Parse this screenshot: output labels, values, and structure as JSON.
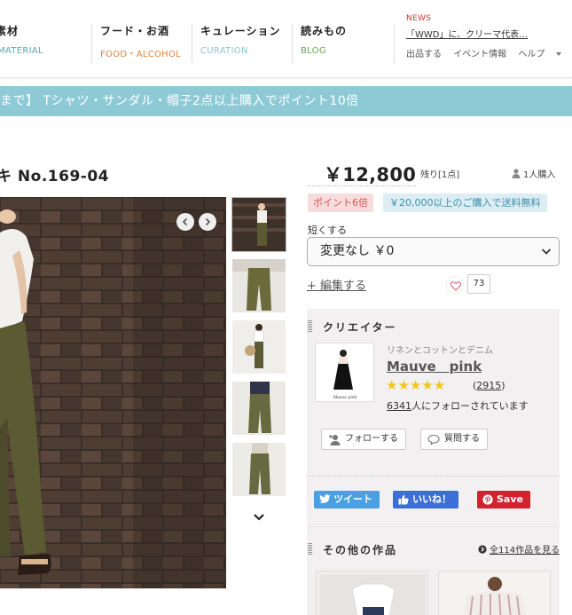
{
  "nav": {
    "items": [
      {
        "jp": "素材",
        "en": "MATERIAL"
      },
      {
        "jp": "フード・お酒",
        "en": "FOOD・ALCOHOL"
      },
      {
        "jp": "キュレーション",
        "en": "CURATION"
      },
      {
        "jp": "読みもの",
        "en": "BLOG"
      }
    ],
    "news_label": "NEWS",
    "news_text": "「WWD」に、クリーマ代表…",
    "links": [
      "出品する",
      "イベント情報",
      "ヘルプ"
    ]
  },
  "banner": {
    "text": "まで】 Tシャツ・サンダル・帽子2点以上購入でポイント10倍"
  },
  "product": {
    "title": "キ No.169-04",
    "price": "￥12,800",
    "stock": "残り[1点]",
    "buyers": "1人購入",
    "point_badge": "ポイント6倍",
    "shipping_badge": "￥20,000以上のご購入で送料無料",
    "option_label": "短くする",
    "option_value": "変更なし ￥0",
    "edit_label": "+ 編集する",
    "fav_count": "73"
  },
  "creator": {
    "heading": "クリエイター",
    "subtitle": "リネンとコットンとデニム",
    "name": "Mauve　pink",
    "rating": 5,
    "stars_text": "★★★★★",
    "review_count": "2915",
    "followers": "6341",
    "followers_suffix": "人にフォローされています",
    "follow_label": "フォローする",
    "question_label": "質問する",
    "avatar_caption": "Mauve pink"
  },
  "share": {
    "tweet": "ツイート",
    "like": "いいね！",
    "pin": "Save"
  },
  "other_works": {
    "heading": "その他の作品",
    "link": "全114作品を見る"
  },
  "colors": {
    "banner": "#8ecad6",
    "material": "#59a9b4",
    "food": "#e0843b",
    "curation": "#8ec5cf",
    "blog": "#63a54a",
    "news": "#dd3333",
    "star": "#f2c51b",
    "twitter": "#4aa0e0",
    "facebook": "#3b6fd6",
    "pinterest": "#d2222d"
  }
}
